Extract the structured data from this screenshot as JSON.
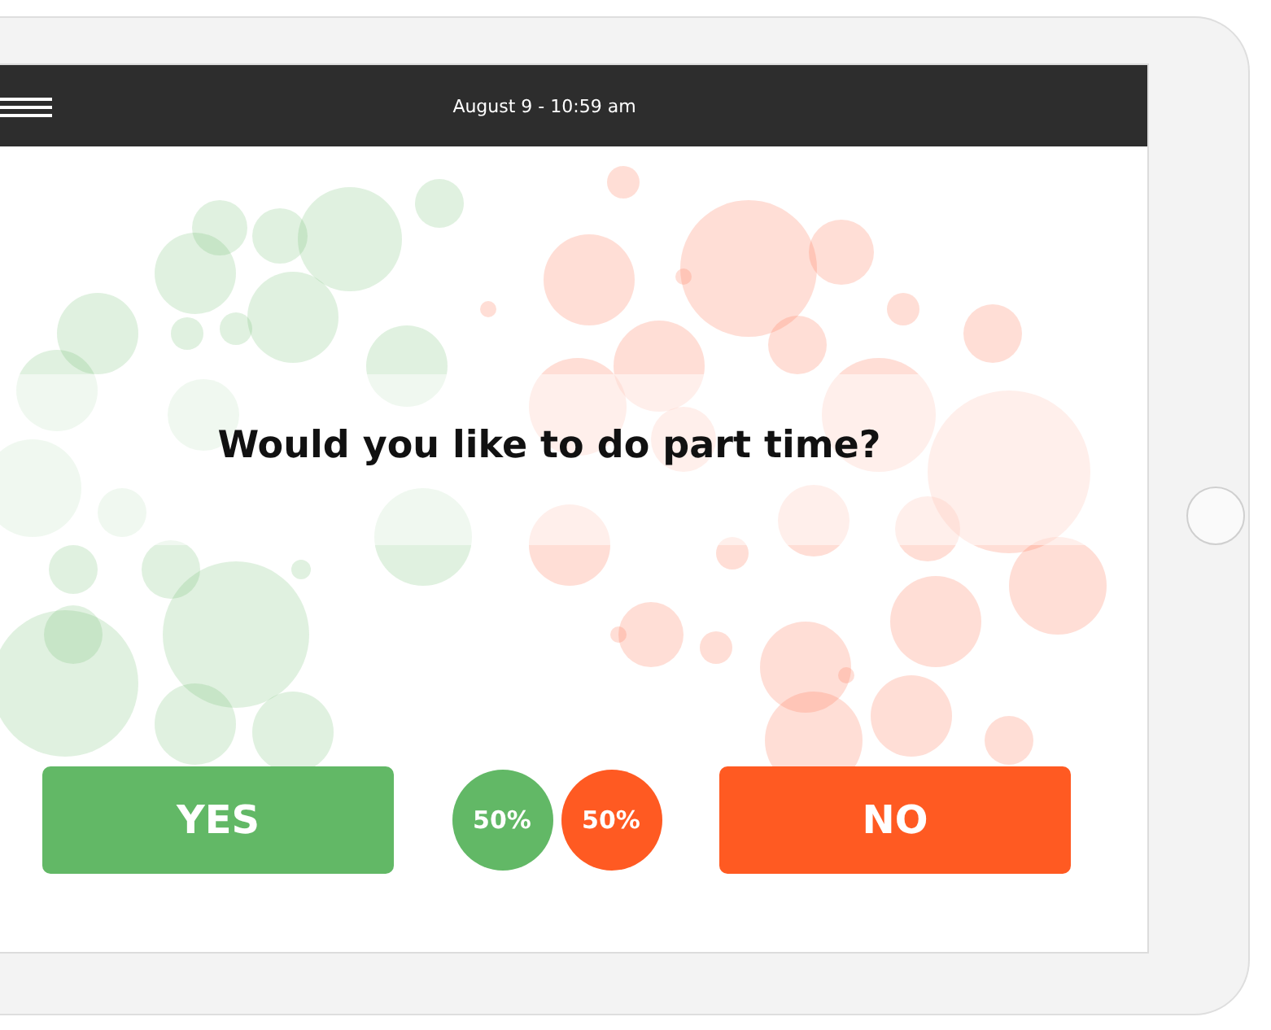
{
  "top_bar": {
    "datetime": "August 9 - 10:59 am"
  },
  "question": "Would you like to do part time?",
  "answers": [
    {
      "label": "YES",
      "color": "#62b866",
      "share": "50%"
    },
    {
      "label": "NO",
      "color": "#ff5a22",
      "share": "50%"
    }
  ]
}
